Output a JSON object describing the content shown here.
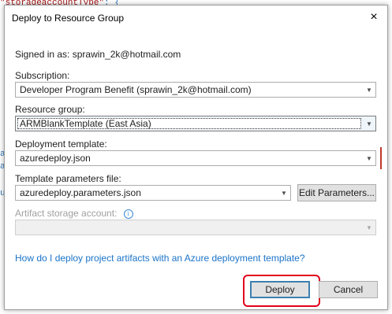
{
  "background": {
    "code_fragment_a": "\"storageaccountType\"",
    "code_fragment_b": ": {",
    "marks": [
      "a",
      "a",
      "u"
    ]
  },
  "dialog": {
    "title": "Deploy to Resource Group",
    "close_glyph": "×",
    "signed_in_label": "Signed in as:",
    "signed_in_user": "sprawin_2k@hotmail.com",
    "subscription": {
      "label": "Subscription:",
      "value": "Developer Program Benefit (sprawin_2k@hotmail.com)"
    },
    "resource_group": {
      "label": "Resource group:",
      "value": "ARMBlankTemplate (East Asia)"
    },
    "deployment_template": {
      "label": "Deployment template:",
      "value": "azuredeploy.json"
    },
    "template_parameters": {
      "label": "Template parameters file:",
      "value": "azuredeploy.parameters.json",
      "edit_button": "Edit Parameters..."
    },
    "artifact_storage": {
      "label": "Artifact storage account:",
      "info_glyph": "i",
      "value": ""
    },
    "help_link": "How do I deploy project artifacts with an Azure deployment template?",
    "buttons": {
      "deploy": "Deploy",
      "cancel": "Cancel"
    },
    "annotation_color": "#e0001a",
    "link_color": "#1a73c7"
  }
}
